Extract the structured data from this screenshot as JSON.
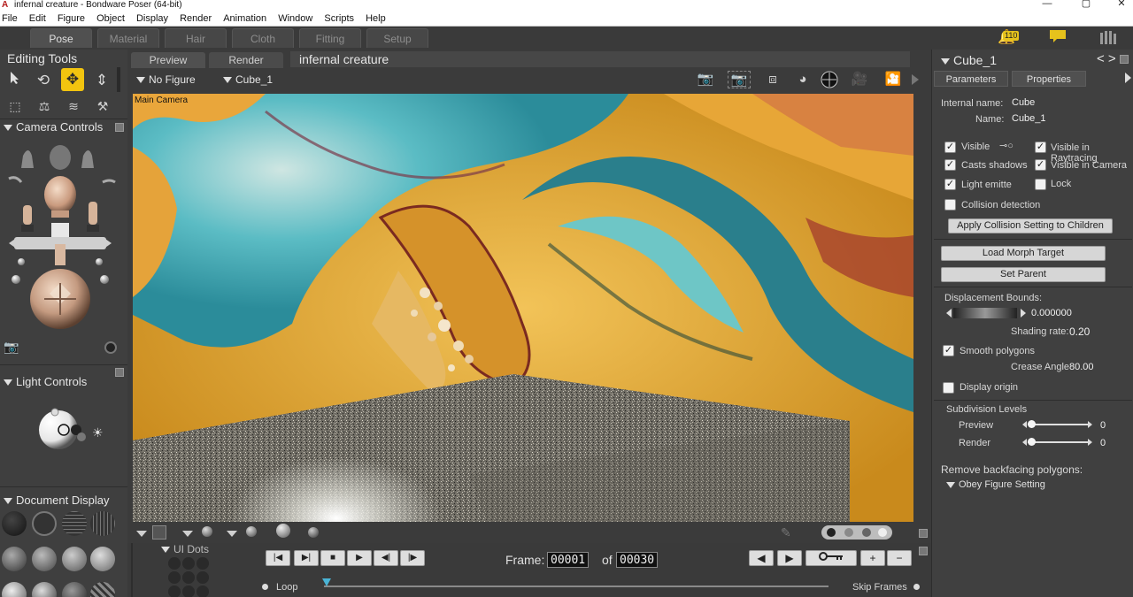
{
  "window": {
    "title": "infernal creature - Bondware Poser (64-bit)",
    "controls": [
      "—",
      "▢",
      "✕"
    ]
  },
  "menubar": [
    "File",
    "Edit",
    "Figure",
    "Object",
    "Display",
    "Render",
    "Animation",
    "Window",
    "Scripts",
    "Help"
  ],
  "rooms": {
    "tabs": [
      "Pose",
      "Material",
      "Hair",
      "Cloth",
      "Fitting",
      "Setup"
    ],
    "active": "Pose",
    "notification_count": "110"
  },
  "left_panel": {
    "editing_tools_title": "Editing Tools",
    "camera_controls_title": "Camera Controls",
    "light_controls_title": "Light Controls",
    "document_display_title": "Document  Display",
    "ui_dots_label": "UI Dots"
  },
  "viewport": {
    "tabs": [
      "Preview",
      "Render"
    ],
    "active_tab": "Preview",
    "document_title": "infernal creature",
    "figure_selector": "No Figure",
    "actor_selector": "Cube_1",
    "camera_label": "Main Camera"
  },
  "timeline": {
    "frame_label": "Frame:",
    "current_frame": "00001",
    "of_label": "of",
    "total_frames": "00030",
    "loop_label": "Loop",
    "skip_frames_label": "Skip Frames"
  },
  "properties": {
    "actor_title": "Cube_1",
    "tabs": [
      "Parameters",
      "Properties"
    ],
    "active_tab": "Properties",
    "internal_name_label": "Internal name:",
    "internal_name_value": "Cube",
    "name_label": "Name:",
    "name_value": "Cube_1",
    "visible_label": "Visible",
    "visible_raytracing_label": "Visible in Raytracing",
    "casts_shadows_label": "Casts shadows",
    "visible_camera_label": "Visible in Camera",
    "light_emitter_label": "Light emitte",
    "lock_label": "Lock",
    "collision_label": "Collision detection",
    "apply_collision_button": "Apply Collision Setting to Children",
    "load_morph_button": "Load Morph Target",
    "set_parent_button": "Set Parent",
    "displacement_label": "Displacement Bounds:",
    "displacement_value": "0.000000",
    "shading_rate_label": "Shading rate:",
    "shading_rate_value": "0.20",
    "smooth_polygons_label": "Smooth polygons",
    "crease_angle_label": "Crease Angle",
    "crease_angle_value": "80.00",
    "display_origin_label": "Display origin",
    "subdivision_label": "Subdivision Levels",
    "preview_label": "Preview",
    "preview_value": "0",
    "render_label": "Render",
    "render_value": "0",
    "backfacing_label": "Remove backfacing polygons:",
    "backfacing_option": "Obey Figure Setting"
  },
  "checks": {
    "visible": true,
    "visible_raytracing": true,
    "casts_shadows": true,
    "visible_camera": true,
    "light_emitter": true,
    "lock": false,
    "collision": false,
    "smooth_polygons": true,
    "display_origin": false
  }
}
